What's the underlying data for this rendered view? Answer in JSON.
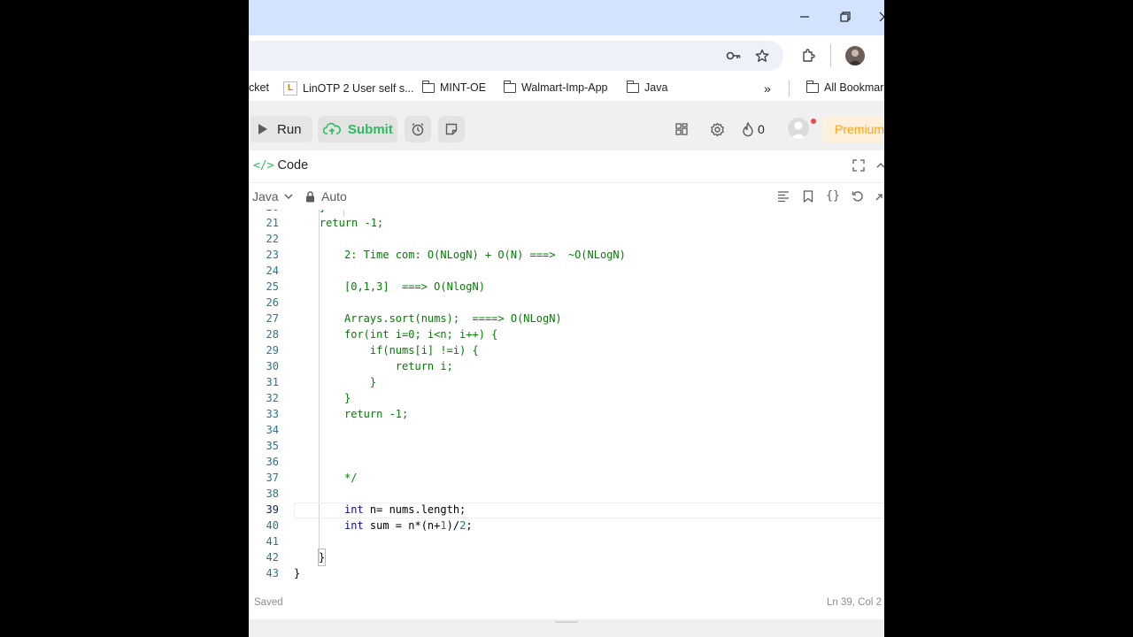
{
  "window": {
    "minimize_icon": "minimize-icon",
    "restore_icon": "restore-icon",
    "close_icon": "close-icon"
  },
  "addressbar": {
    "password_icon": "key-icon",
    "star_icon": "star-icon",
    "extensions_icon": "puzzle-icon",
    "profile_icon": "avatar"
  },
  "bookmarks": {
    "items": [
      {
        "label": "cket",
        "icon": "none"
      },
      {
        "label": "LinOTP 2 User self s...",
        "icon": "linotp-favicon"
      },
      {
        "label": "MINT-OE",
        "icon": "folder-icon"
      },
      {
        "label": "Walmart-Imp-App",
        "icon": "folder-icon"
      },
      {
        "label": "Java",
        "icon": "folder-icon"
      }
    ],
    "overflow_icon": "chevron-double-right-icon",
    "all_bookmarks": "All Bookmar"
  },
  "toolbar": {
    "run_label": "Run",
    "submit_label": "Submit",
    "streak_count": "0",
    "premium_label": "Premium",
    "colors": {
      "submit": "#2cbb5d",
      "premium": "#ffa116"
    }
  },
  "code": {
    "title": "Code",
    "language": "Java",
    "mode": "Auto",
    "lines": [
      {
        "n": "21",
        "text": "    return -1;"
      },
      {
        "n": "22",
        "text": ""
      },
      {
        "n": "23",
        "text": "2: Time com: O(NLogN) + O(N) ===>  ~O(NLogN)"
      },
      {
        "n": "24",
        "text": ""
      },
      {
        "n": "25",
        "text": "[0,1,3]  ===> O(NlogN)"
      },
      {
        "n": "26",
        "text": ""
      },
      {
        "n": "27",
        "text": "Arrays.sort(nums);  ====> O(NLogN)"
      },
      {
        "n": "28",
        "text": "for(int i=0; i<n; i++) {"
      },
      {
        "n": "29",
        "text": "    if(nums[i] !=i) {"
      },
      {
        "n": "30",
        "text": "        return i;"
      },
      {
        "n": "31",
        "text": "    }"
      },
      {
        "n": "32",
        "text": "}"
      },
      {
        "n": "33",
        "text": "return -1;"
      },
      {
        "n": "34",
        "text": ""
      },
      {
        "n": "35",
        "text": ""
      },
      {
        "n": "36",
        "text": ""
      },
      {
        "n": "37",
        "text": "*/"
      },
      {
        "n": "38",
        "text": ""
      },
      {
        "n": "39",
        "text": "int n= nums.length;"
      },
      {
        "n": "40",
        "text": "int sum = n*(n+1)/2;"
      },
      {
        "n": "41",
        "text": ""
      },
      {
        "n": "42",
        "text": "}"
      },
      {
        "n": "43",
        "text": "}"
      }
    ],
    "saved_label": "Saved",
    "cursor_position": "Ln 39, Col 2"
  }
}
